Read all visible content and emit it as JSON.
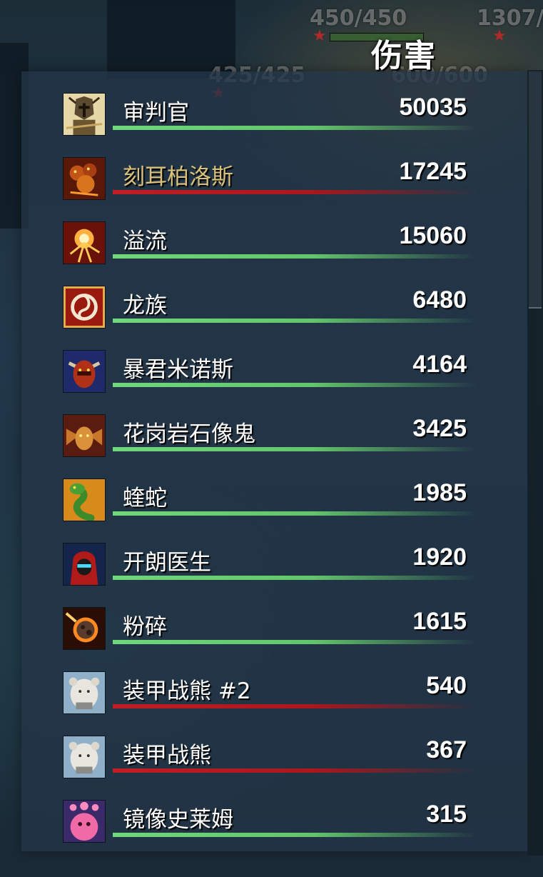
{
  "header": {
    "title": "伤害"
  },
  "overhead": {
    "hp_left": "425/425",
    "hp_top_center": "450/450",
    "hp_top_right": "1307/",
    "hp_center_right": "600/600"
  },
  "colors": {
    "ally_bar": "#6fd87a",
    "enemy_bar": "#c01e24",
    "highlight_name": "#d8c07a"
  },
  "rows": [
    {
      "name": "审判官",
      "value": "50035",
      "bar": "green",
      "icon": "helmet-knight-icon"
    },
    {
      "name": "刻耳柏洛斯",
      "value": "17245",
      "bar": "red",
      "icon": "cerberus-icon",
      "highlight": true
    },
    {
      "name": "溢流",
      "value": "15060",
      "bar": "green",
      "icon": "eruption-icon"
    },
    {
      "name": "龙族",
      "value": "6480",
      "bar": "green",
      "icon": "dragon-emblem-icon"
    },
    {
      "name": "暴君米诺斯",
      "value": "4164",
      "bar": "green",
      "icon": "minotaur-icon"
    },
    {
      "name": "花岗岩石像鬼",
      "value": "3425",
      "bar": "green",
      "icon": "gargoyle-icon"
    },
    {
      "name": "蝰蛇",
      "value": "1985",
      "bar": "green",
      "icon": "viper-icon"
    },
    {
      "name": "开朗医生",
      "value": "1920",
      "bar": "green",
      "icon": "hooded-doctor-icon"
    },
    {
      "name": "粉碎",
      "value": "1615",
      "bar": "green",
      "icon": "meteor-icon"
    },
    {
      "name": "装甲战熊 #2",
      "value": "540",
      "bar": "red",
      "icon": "armored-bear-icon"
    },
    {
      "name": "装甲战熊",
      "value": "367",
      "bar": "red",
      "icon": "armored-bear-icon"
    },
    {
      "name": "镜像史莱姆",
      "value": "315",
      "bar": "green",
      "icon": "pink-slime-icon"
    }
  ]
}
